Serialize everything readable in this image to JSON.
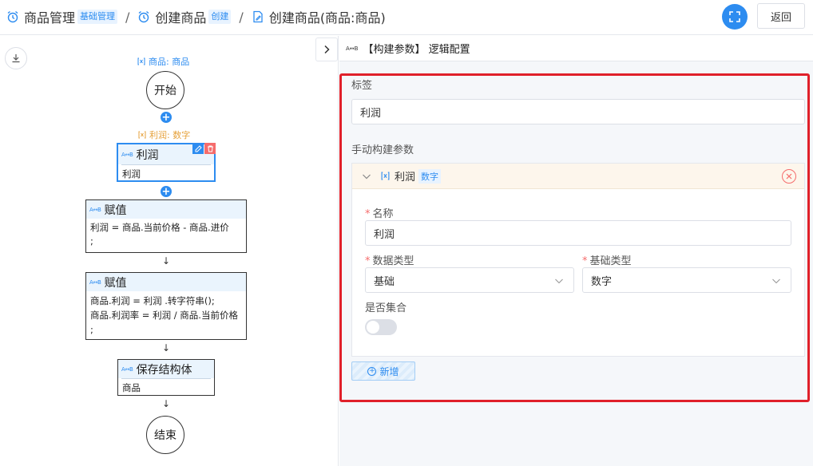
{
  "header": {
    "breadcrumbs": [
      {
        "label": "商品管理",
        "badge": "基础管理"
      },
      {
        "label": "创建商品",
        "badge": "创建"
      },
      {
        "label": "创建商品(商品:商品)"
      }
    ],
    "separator": "/",
    "back_label": "返回"
  },
  "canvas": {
    "input_var": "商品: 商品",
    "start_label": "开始",
    "end_label": "结束",
    "plus_glyph": "+",
    "arrow_glyph": "↓",
    "output_var": "利润: 数字",
    "nodes": [
      {
        "icon": "A↔B",
        "title": "利润",
        "body": [
          "利润"
        ]
      },
      {
        "icon": "A↔B",
        "title": "赋值",
        "body": [
          "利润 = 商品.当前价格 - 商品.进价",
          ";"
        ]
      },
      {
        "icon": "A↔B",
        "title": "赋值",
        "body": [
          "商品.利润 = 利润 .转字符串();",
          "商品.利润率 = 利润 / 商品.当前价格",
          ";"
        ]
      },
      {
        "icon": "A↔B",
        "title": "保存结构体",
        "body": [
          "商品"
        ]
      }
    ]
  },
  "panel": {
    "icon": "A↔B",
    "title": "【构建参数】 逻辑配置",
    "tag_label": "标签",
    "tag_value": "利润",
    "section_label": "手动构建参数",
    "param": {
      "name": "利润",
      "type_badge": "数字",
      "name_label": "名称",
      "name_value": "利润",
      "data_type_label": "数据类型",
      "data_type_value": "基础",
      "base_type_label": "基础类型",
      "base_type_value": "数字",
      "collection_label": "是否集合",
      "collection_on": false
    },
    "add_label": "新增"
  },
  "colors": {
    "accent": "#2d8cf0",
    "danger": "#f56c6c",
    "highlight": "#e0202a",
    "var_orange": "#e6a23c"
  }
}
